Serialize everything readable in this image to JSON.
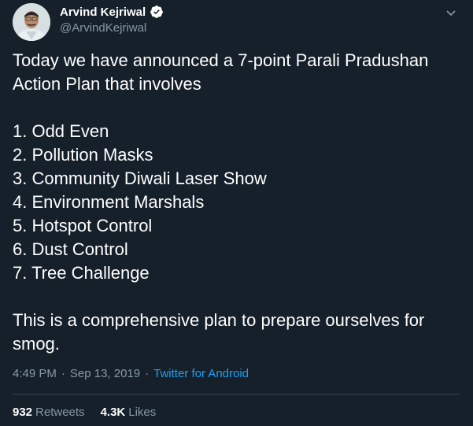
{
  "author": {
    "display_name": "Arvind Kejriwal",
    "handle": "@ArvindKejriwal",
    "verified": true
  },
  "tweet": {
    "intro": "Today we have announced a 7-point Parali Pradushan Action Plan that involves",
    "points": [
      "1. Odd Even",
      "2. Pollution Masks",
      "3. Community Diwali Laser Show",
      "4. Environment Marshals",
      "5. Hotspot Control",
      "6. Dust Control",
      "7. Tree Challenge"
    ],
    "closing": "This is a comprehensive plan to prepare ourselves for smog."
  },
  "meta": {
    "time": "4:49 PM",
    "sep1": "·",
    "date": "Sep 13, 2019",
    "sep2": "·",
    "source": "Twitter for Android"
  },
  "stats": {
    "retweets_count": "932",
    "retweets_label": "Retweets",
    "likes_count": "4.3K",
    "likes_label": "Likes"
  },
  "colors": {
    "background": "#15202b",
    "secondary_text": "#8899a6",
    "link": "#1da1f2",
    "divider": "#38444d"
  },
  "icons": [
    "avatar",
    "verified-badge-icon",
    "chevron-down-icon"
  ]
}
